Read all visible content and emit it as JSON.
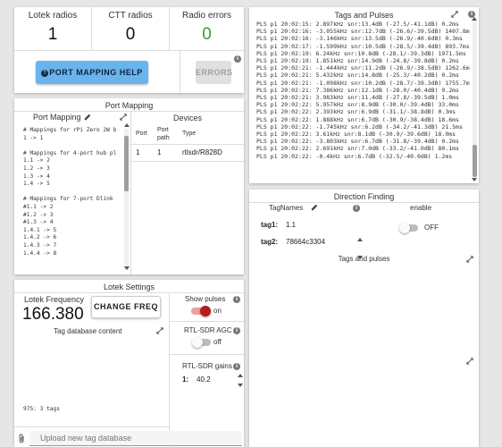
{
  "colors": {
    "accent_green": "#2e9e33",
    "help_button_bg": "#6ab4ee",
    "toggle_on": "#b71c1c",
    "toggle_on_track": "#e8a0a0",
    "disabled_bg": "#e0e0e0"
  },
  "stats": {
    "lotek_label": "Lotek radios",
    "lotek_value": "1",
    "ctt_label": "CTT radios",
    "ctt_value": "0",
    "errors_label": "Radio errors",
    "errors_value": "0"
  },
  "buttons": {
    "help_label": "PORT MAPPING HELP",
    "errors_label": "ERRORS",
    "change_freq_label": "CHANGE FREQ"
  },
  "port_mapping": {
    "section_title": "Port Mapping",
    "panel_title": "Port Mapping",
    "text_lines": [
      "# Mappings for rPi Zero 2W b",
      "1 -> 1",
      "",
      "# Mappings for 4-port hub pl",
      "1.1 -> 2",
      "1.2 -> 3",
      "1.3 -> 4",
      "1.4 -> 5",
      "",
      "# Mappings for 7-port Dlink",
      "#1.1 -> 2",
      "#1.2 -> 3",
      "#1.3 -> 4",
      "1.4.1 -> 5",
      "1.4.2 -> 6",
      "1.4.3 -> 7",
      "1.4.4 -> 8"
    ]
  },
  "devices": {
    "title": "Devices",
    "headers": [
      "Port",
      "Port path",
      "Type"
    ],
    "rows": [
      [
        "1",
        "1",
        "rtlsdr/R828D"
      ]
    ]
  },
  "tag_pulses": {
    "title": "Tags and Pulses",
    "lines": [
      "PLS p1 20:02:15: 2.897kHz snr:13.4dB (-27.5/-41.1dB) 0.2ms",
      "PLS p1 20:02:16: -3.055kHz snr:12.7dB (-26.6/-39.5dB) 1407.8m",
      "PLS p1 20:02:16: -3.146kHz snr:13.5dB (-26.9/-40.6dB) 0.3ms",
      "PLS p1 20:02:17: -1.599kHz snr:10.5dB (-28.5/-39.4dB) 893.7ms",
      "PLS p1 20:02:19: 6.24kHz snr:10.8dB (-28.1/-39.3dB) 1971.5ms",
      "PLS p1 20:02:19: 1.851kHz snr:14.9dB (-24.8/-39.8dB) 0.2ms",
      "PLS p1 20:02:21: -1.444kHz snr:11.2dB (-26.9/-38.5dB) 1262.6m",
      "PLS p1 20:02:21: 5.432kHz snr:14.8dB (-25.3/-40.2dB) 0.2ms",
      "PLS p1 20:02:21: -1.098kHz snr:10.2dB (-28.7/-39.3dB) 1755.7m",
      "PLS p1 20:02:21: 7.386kHz snr:12.1dB (-28.0/-40.4dB) 0.2ms",
      "PLS p1 20:02:21: 3.983kHz snr:11.4dB (-27.8/-39.5dB) 1.0ms",
      "PLS p1 20:02:22: 5.957kHz snr:8.9dB (-30.0/-39.4dB) 33.0ms",
      "PLS p1 20:02:22: 2.393kHz snr:6.9dB (-31.1/-38.8dB) 0.3ms",
      "PLS p1 20:02:22: 1.888kHz snr:6.7dB (-30.9/-38.4dB) 18.6ms",
      "PLS p1 20:02:22: -1.745kHz snr:6.2dB (-34.2/-41.3dB) 21.5ms",
      "PLS p1 20:02:22: 3.61kHz snr:8.1dB (-30.9/-39.6dB) 18.0ms",
      "PLS p1 20:02:22: -3.803kHz snr:6.7dB (-31.8/-39.4dB) 0.2ms",
      "PLS p1 20:02:22: 2.691kHz snr:7.0dB (-33.2/-41.0dB) 80.1ms",
      "PLS p1 20:02:22: -0.4kHz snr:6.7dB (-32.5/-40.0dB) 1.2ms"
    ]
  },
  "direction_finding": {
    "title": "Direction Finding",
    "tagnames_label": "TagNames",
    "enable_label": "enable",
    "toggle_state": "OFF",
    "tags": [
      {
        "key": "tag1:",
        "value": "1.1"
      },
      {
        "key": "tag2:",
        "value": "78664c3304"
      }
    ],
    "subpanel_title": "Tags and pulses"
  },
  "lotek_settings": {
    "title": "Lotek Settings",
    "freq_label": "Lotek Frequency",
    "freq_value": "166.380",
    "show_pulses_label": "Show pulses",
    "show_pulses_state": "on",
    "tag_db_title": "Tag database content",
    "tag_db_text": "975: 3 tags",
    "agc_label": "RTL-SDR AGC",
    "agc_state": "off",
    "gains_label": "RTL-SDR gains",
    "gains_key": "1:",
    "gains_value": "40.2",
    "upload_placeholder": "Upload new tag database"
  }
}
